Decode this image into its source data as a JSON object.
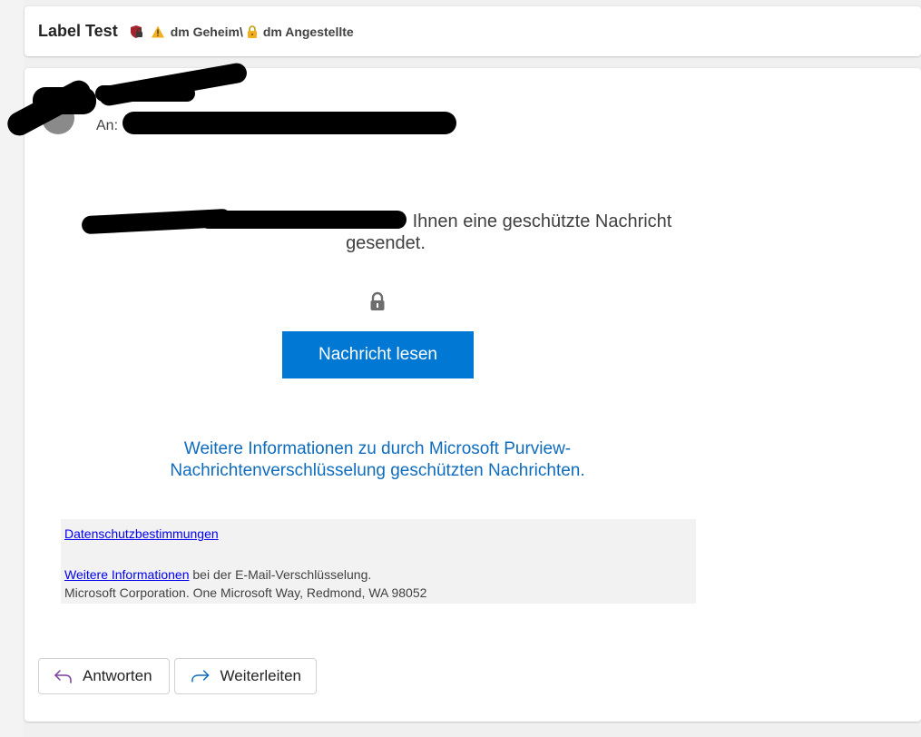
{
  "subject": {
    "title": "Label Test",
    "label_part1": "dm Geheim\\",
    "label_part2": "dm Angestellte"
  },
  "sender": {
    "recipient_prefix": "An:"
  },
  "body": {
    "message_suffix": "Ihnen eine geschützte Nachricht gesendet.",
    "read_button": "Nachricht lesen",
    "info_link": "Weitere Informationen zu durch Microsoft Purview-Nachrichtenverschlüsselung geschützten Nachrichten."
  },
  "footer": {
    "privacy_link": "Datenschutzbestimmungen",
    "more_info_link": "Weitere Informationen",
    "more_info_suffix": " bei der E-Mail-Verschlüsselung.",
    "address": "Microsoft Corporation. One Microsoft Way, Redmond, WA 98052"
  },
  "actions": {
    "reply": "Antworten",
    "forward": "Weiterleiten"
  },
  "icons": {
    "shield": "shield-lock-icon",
    "warning": "warning-icon",
    "lock": "lock-icon",
    "reply": "reply-icon",
    "forward": "forward-icon"
  },
  "colors": {
    "accent": "#0078d4",
    "link": "#0f6cbd",
    "footer_bg": "#f2f2f2"
  }
}
